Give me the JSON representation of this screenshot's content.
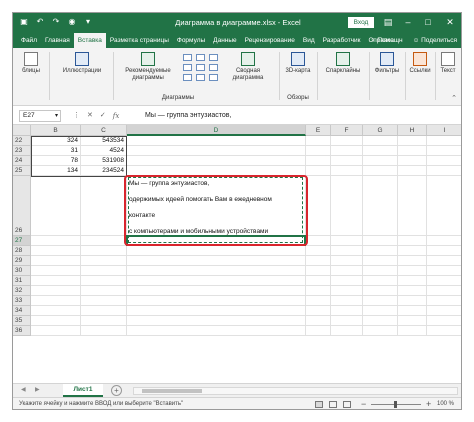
{
  "titlebar": {
    "title": "Диаграмма в диаграмме.xlsx  -  Excel",
    "signin": "Вход",
    "save_icon": "save-icon",
    "undo_icon": "undo-icon",
    "redo_icon": "redo-icon",
    "camera_icon": "camera-icon"
  },
  "ribbon_tabs": [
    "Файл",
    "Главная",
    "Вставка",
    "Разметка страницы",
    "Формулы",
    "Данные",
    "Рецензирование",
    "Вид",
    "Разработчик",
    "Справка"
  ],
  "active_tab": "Вставка",
  "ribbon_right": {
    "search_hint": "Помощн",
    "share": "Поделиться"
  },
  "ribbon_groups": {
    "tables": "блицы",
    "illustrations": "Иллюстрации",
    "recommended_charts": "Рекомендуемые диаграммы",
    "pivot_chart": "Сводная диаграмма",
    "map3d": "3D-карта",
    "sparklines": "Спарклайны",
    "filters": "Фильтры",
    "links": "Ссылки",
    "text": "Текст",
    "group_charts": "Диаграммы",
    "group_tours": "Обзоры"
  },
  "formula_bar": {
    "name_box": "E27",
    "cancel": "✕",
    "enter": "✓",
    "fx": "fx",
    "formula": "Мы — группа энтузиастов,"
  },
  "columns": [
    "B",
    "C",
    "D",
    "E",
    "F",
    "G",
    "H",
    "I"
  ],
  "rows": [
    {
      "num": "22",
      "b": "324",
      "c": "543534"
    },
    {
      "num": "23",
      "b": "31",
      "c": "4524"
    },
    {
      "num": "24",
      "b": "78",
      "c": "531908"
    },
    {
      "num": "25",
      "b": "134",
      "c": "234524"
    },
    {
      "num": "26",
      "b": "",
      "c": ""
    },
    {
      "num": "27",
      "b": "",
      "c": ""
    },
    {
      "num": "28",
      "b": "",
      "c": ""
    },
    {
      "num": "29",
      "b": "",
      "c": ""
    },
    {
      "num": "30",
      "b": "",
      "c": ""
    },
    {
      "num": "31",
      "b": "",
      "c": ""
    },
    {
      "num": "32",
      "b": "",
      "c": ""
    },
    {
      "num": "33",
      "b": "",
      "c": ""
    },
    {
      "num": "34",
      "b": "",
      "c": ""
    },
    {
      "num": "35",
      "b": "",
      "c": ""
    },
    {
      "num": "36",
      "b": "",
      "c": ""
    }
  ],
  "pasted_text": [
    "Мы — группа энтузиастов,",
    "одержимых идеей помогать Вам в ежедневном",
    "контакте",
    "с компьютерами и мобильными устройствами"
  ],
  "sheet_tab": "Лист1",
  "status": {
    "message": "Укажите ячейку и нажмите ВВОД или выберите \"Вставить\"",
    "zoom": "100 %",
    "zoom_minus": "−",
    "zoom_plus": "+"
  },
  "colors": {
    "excel_green": "#217346",
    "highlight_red": "#d8262e"
  }
}
